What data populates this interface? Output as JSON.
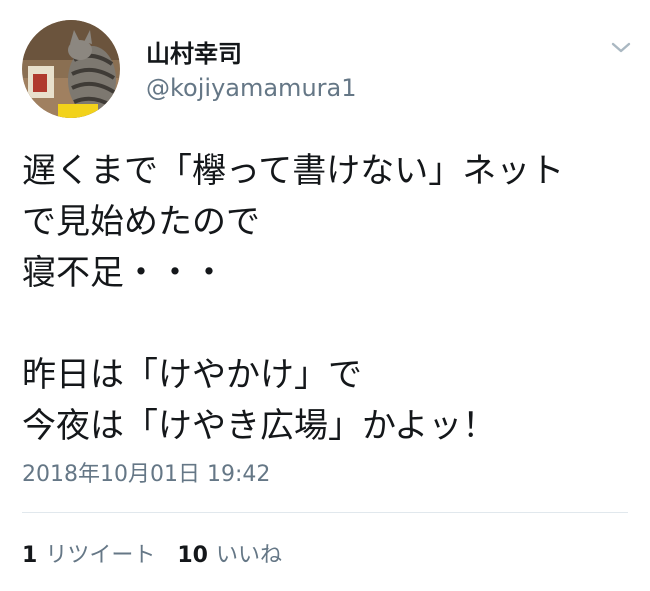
{
  "user": {
    "display_name": "山村幸司",
    "handle": "@kojiyamamura1"
  },
  "tweet": {
    "lines": [
      "遅くまで「欅って書けない」ネット",
      "で見始めたので",
      "寝不足・・・",
      "",
      "昨日は「けやかけ」で",
      "今夜は「けやき広場」かよッ！"
    ],
    "timestamp": "2018年10月01日 19:42"
  },
  "stats": {
    "retweets": {
      "count": "1",
      "label": "リツイート"
    },
    "likes": {
      "count": "10",
      "label": "いいね"
    }
  },
  "icons": {
    "menu": "chevron-down-icon",
    "avatar": "cat-photo-avatar"
  },
  "colors": {
    "text": "#14171a",
    "secondary": "#657786",
    "divider": "#e1e8ed"
  }
}
